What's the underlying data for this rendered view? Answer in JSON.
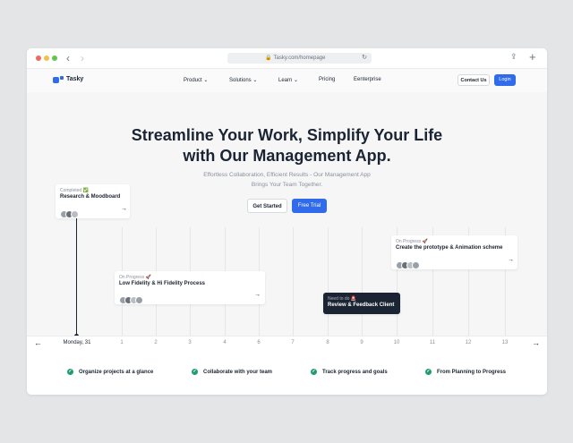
{
  "browser": {
    "url": "Tasky.com/homepage",
    "back_icon": "chevron-left-icon",
    "forward_icon": "chevron-right-icon"
  },
  "nav": {
    "brand": "Tasky",
    "menu": [
      {
        "label": "Product",
        "has_dropdown": true
      },
      {
        "label": "Solutions",
        "has_dropdown": true
      },
      {
        "label": "Learn",
        "has_dropdown": true
      },
      {
        "label": "Pricing",
        "has_dropdown": false
      },
      {
        "label": "Eenterprise",
        "has_dropdown": false
      }
    ],
    "contact_label": "Contact Us",
    "login_label": "Login"
  },
  "hero": {
    "title_line1": "Streamline Your Work, Simplify Your Life",
    "title_line2": "with Our Management App.",
    "subtitle_line1": "Effortless Collaboration, Efficient Results - Our Management App",
    "subtitle_line2": "Brings Your Team Together.",
    "get_started_label": "Get Started",
    "free_trial_label": "Free Trial"
  },
  "cards": [
    {
      "status": "Completed ✅",
      "title": "Research & Moodboard"
    },
    {
      "status": "On Progress 🚀",
      "title": "Low Fidelity & Hi Fidelity Process"
    },
    {
      "status": "Need to do 🚨",
      "title": "Review & Feedback Client"
    },
    {
      "status": "On Progress 🚀",
      "title": "Create the prototype & Animation scheme"
    }
  ],
  "timeline": {
    "ticks": [
      "Monday, 31",
      "1",
      "2",
      "3",
      "4",
      "6",
      "7",
      "8",
      "9",
      "10",
      "11",
      "12",
      "13"
    ]
  },
  "features": [
    "Organize projects at a glance",
    "Collaborate with your team",
    "Track progress and goals",
    "From Planning to Progress"
  ],
  "colors": {
    "accent": "#2f6bea",
    "check": "#1f9d6b",
    "dark": "#1b2433"
  }
}
